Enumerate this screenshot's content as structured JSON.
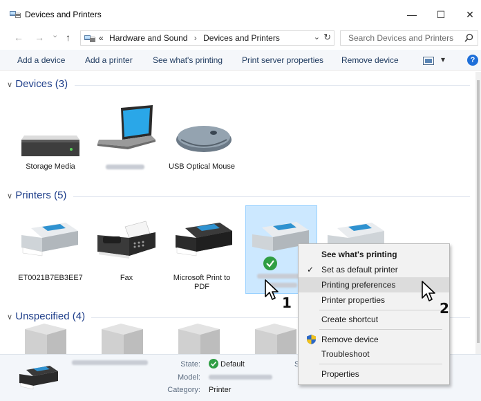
{
  "window": {
    "title": "Devices and Printers",
    "minimize_glyph": "—",
    "maximize_glyph": "☐",
    "close_glyph": "✕"
  },
  "address": {
    "back_glyph": "←",
    "forward_glyph": "→",
    "recent_glyph": "⌄",
    "up_glyph": "↑",
    "overflow": "«",
    "crumb1": "Hardware and Sound",
    "crumb_sep": "›",
    "crumb2": "Devices and Printers",
    "dropdown_glyph": "⌄",
    "refresh_glyph": "↻",
    "search_placeholder": "Search Devices and Printers"
  },
  "commands": {
    "add_device": "Add a device",
    "add_printer": "Add a printer",
    "see_printing": "See what's printing",
    "server_props": "Print server properties",
    "remove_device": "Remove device",
    "view_glyph": "▾",
    "help": "?"
  },
  "groups": {
    "devices": "Devices (3)",
    "printers": "Printers (5)",
    "unspecified": "Unspecified (4)",
    "chevron": "∨"
  },
  "devices": {
    "storage": "Storage Media",
    "mouse": "USB Optical Mouse"
  },
  "printers": {
    "p1": "ET0021B7EB3EE7",
    "fax": "Fax",
    "pdf": "Microsoft Print to PDF"
  },
  "details": {
    "state_key": "State:",
    "state_val": "Default",
    "model_key": "Model:",
    "category_key": "Category:",
    "category_val": "Printer",
    "s_key": "S"
  },
  "context_menu": {
    "see_printing": "See what's printing",
    "check_glyph": "✓",
    "set_default": "Set as default printer",
    "printing_prefs": "Printing preferences",
    "printer_props": "Printer properties",
    "create_shortcut": "Create shortcut",
    "remove_device": "Remove device",
    "troubleshoot": "Troubleshoot",
    "properties": "Properties"
  },
  "steps": {
    "one": "1",
    "two": "2"
  },
  "colors": {
    "group_header": "#1e3e8a",
    "selection": "#cce8ff",
    "default_check": "#2f9e44",
    "help_button": "#1e6fd9"
  }
}
